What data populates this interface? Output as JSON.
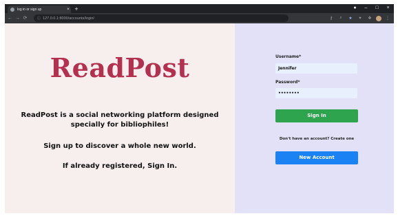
{
  "browser": {
    "tab_title": "log in or sign up",
    "tab_close": "×",
    "new_tab": "+",
    "url": "127.0.0.1:8000/accounts/login/",
    "window_controls": {
      "record": "●",
      "minimize": "–",
      "maximize": "□",
      "close": "×"
    },
    "nav": {
      "back": "←",
      "forward": "→",
      "reload": "⟳"
    },
    "icons": {
      "key": "key-icon",
      "zoom": "zoom-icon",
      "star": "★",
      "extension": "extension-icon",
      "menu": "⋮"
    }
  },
  "page": {
    "brand": "ReadPost",
    "tagline_1": "ReadPost is a social networking platform designed specially for bibliophiles!",
    "tagline_2": "Sign up to discover a whole new world.",
    "tagline_3": "If already registered, Sign In.",
    "colors": {
      "left_bg": "#f7eeee",
      "right_bg": "#e2e1f7",
      "brand": "#b3304f",
      "signin": "#2ea44f",
      "new_account": "#1b82f3"
    }
  },
  "form": {
    "username_label": "Username*",
    "username_value": "Jennifer",
    "password_label": "Password*",
    "password_value": "••••••••",
    "signin_label": "Sign In",
    "no_account_text": "Don't have an account? Create one",
    "new_account_label": "New Account"
  }
}
